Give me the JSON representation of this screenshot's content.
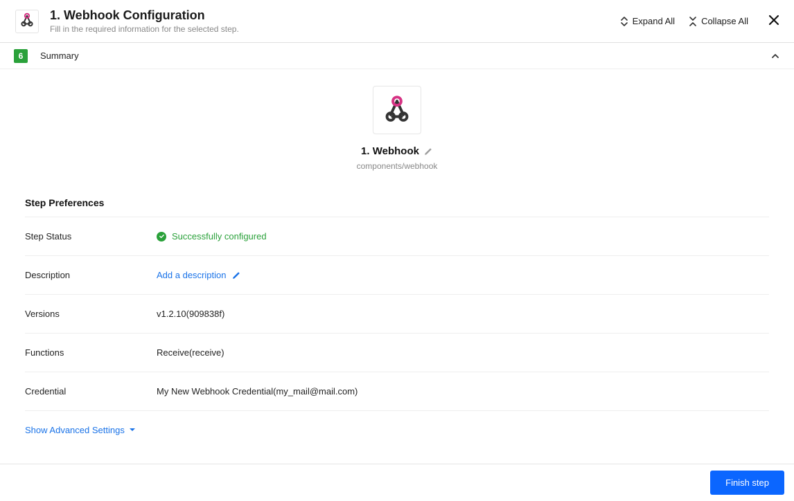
{
  "header": {
    "title": "1. Webhook Configuration",
    "subtitle": "Fill in the required information for the selected step.",
    "expand_all": "Expand All",
    "collapse_all": "Collapse All"
  },
  "summary": {
    "step_number": "6",
    "label": "Summary"
  },
  "step": {
    "name": "1. Webhook",
    "path": "components/webhook"
  },
  "prefs": {
    "title": "Step Preferences",
    "status_label": "Step Status",
    "status_value": "Successfully configured",
    "description_label": "Description",
    "description_action": "Add a description",
    "versions_label": "Versions",
    "versions_value": "v1.2.10(909838f)",
    "functions_label": "Functions",
    "functions_value": "Receive(receive)",
    "credential_label": "Credential",
    "credential_value": "My New Webhook Credential(my_mail@mail.com)"
  },
  "advanced_link": "Show Advanced Settings",
  "footer": {
    "finish": "Finish step"
  },
  "icons": {
    "webhook": "webhook-icon",
    "expand": "expand-icon",
    "collapse": "collapse-icon",
    "close": "close-icon",
    "chevron_up": "chevron-up-icon",
    "pencil": "pencil-icon",
    "check": "check-icon",
    "caret_down": "caret-down-icon"
  }
}
